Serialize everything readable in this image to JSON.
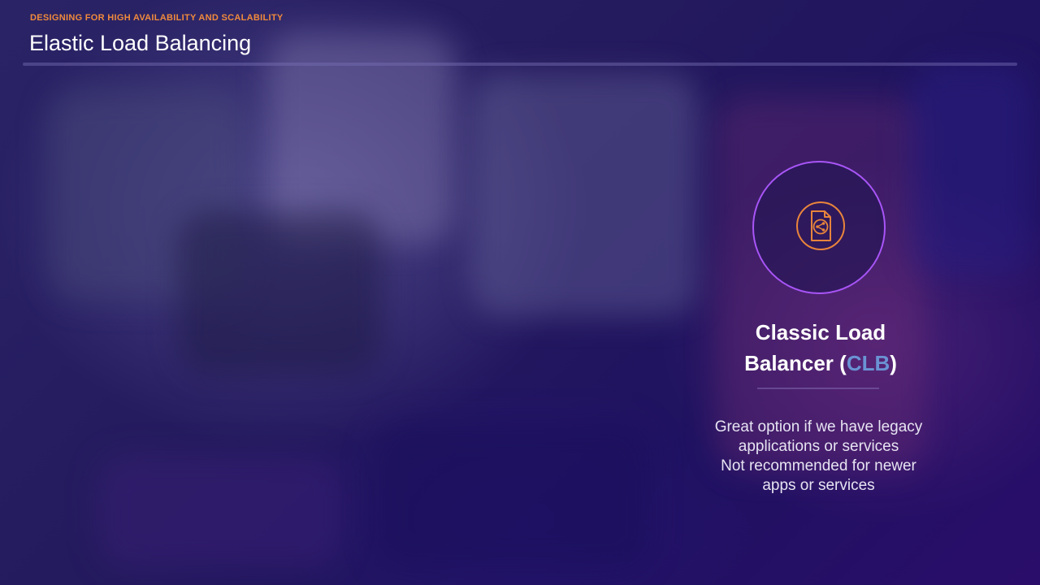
{
  "header": {
    "eyebrow": "DESIGNING FOR HIGH AVAILABILITY AND SCALABILITY",
    "title": "Elastic Load Balancing"
  },
  "card": {
    "icon": "load-balancer-document-share-icon",
    "title_line1": "Classic Load",
    "title_line2_prefix": "Balancer (",
    "title_abbr": "CLB",
    "title_line2_suffix": ")",
    "description_lines": [
      "Great option if we have legacy",
      "applications or services",
      "Not recommended for newer",
      "apps or services"
    ]
  },
  "colors": {
    "eyebrow": "#f08a3c",
    "ring": "#a855f7",
    "icon": "#e8843c",
    "abbr": "#6a93d4",
    "background": "#1e1550"
  }
}
